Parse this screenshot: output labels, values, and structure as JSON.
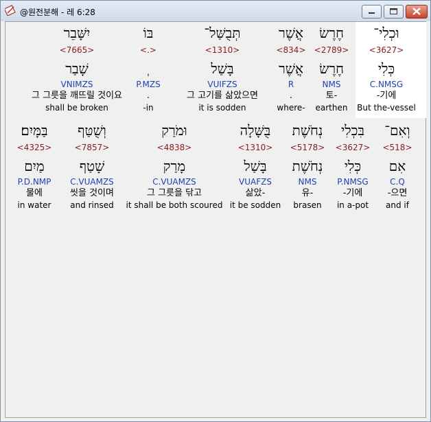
{
  "window": {
    "title": "@원전분해 - 레 6:28",
    "buttons": {
      "minimize": "minimize-icon",
      "maximize": "maximize-icon",
      "close": "close-icon"
    }
  },
  "rows": [
    {
      "words": [
        {
          "heb": "יִשָּׁבֵר",
          "strong": "<7665>",
          "lemma": "שָׁבַר",
          "morph": "VNIMZS",
          "kor": "그 그릇을 깨뜨릴 것이요",
          "eng": "shall be broken"
        },
        {
          "heb": "בּוֹ",
          "strong": "<.>",
          "lemma": "ְ",
          "morph": "P.MZS",
          "kor": ".",
          "eng": "-in"
        },
        {
          "heb": "תְּבֻשַּׁל־",
          "strong": "<1310>",
          "lemma": "בָּשַׁל",
          "morph": "VUIFZS",
          "kor": "그 고기를 삶았으면",
          "eng": "it is sodden"
        },
        {
          "heb": "אֲשֶׁר",
          "strong": "<834>",
          "lemma": "אֲשֶׁר",
          "morph": "R",
          "kor": ".",
          "eng": "where-"
        },
        {
          "heb": "חֶרֶשׂ",
          "strong": "<2789>",
          "lemma": "חֶרֶשׂ",
          "morph": "NMS",
          "kor": "토-",
          "eng": "earthen"
        },
        {
          "heb": "וּכְלִי־",
          "strong": "<3627>",
          "lemma": "כְּלִי",
          "morph": "C.NMSG",
          "kor": "-기에",
          "eng": "But the-vessel"
        }
      ]
    },
    {
      "words": [
        {
          "heb": "בַּמָּיִם׃",
          "strong": "<4325>",
          "lemma": "מַיִם",
          "morph": "P.D.NMP",
          "kor": "물에",
          "eng": "in water"
        },
        {
          "heb": "וְשֻׁטַּף",
          "strong": "<7857>",
          "lemma": "שָׁטַף",
          "morph": "C.VUAMZS",
          "kor": "씻을 것이며",
          "eng": "and rinsed"
        },
        {
          "heb": "וּמֹרַק",
          "strong": "<4838>",
          "lemma": "מָרַק",
          "morph": "C.VUAMZS",
          "kor": "그 그릇을 닦고",
          "eng": "it shall be both scoured"
        },
        {
          "heb": "בֻּשָּׁלָה",
          "strong": "<1310>",
          "lemma": "בָּשַׁל",
          "morph": "VUAFZS",
          "kor": "삶았-",
          "eng": "it be sodden"
        },
        {
          "heb": "נְחֹשֶׁת",
          "strong": "<5178>",
          "lemma": "נְחֹשֶׁת",
          "morph": "NMS",
          "kor": "유-",
          "eng": "brasen"
        },
        {
          "heb": "בִּכְלִי",
          "strong": "<3627>",
          "lemma": "כְּלִי",
          "morph": "P.NMSG",
          "kor": "-기에",
          "eng": "in a-pot"
        },
        {
          "heb": "וְאִם־",
          "strong": "<518>",
          "lemma": "אִם",
          "morph": "C.Q",
          "kor": "-으면",
          "eng": "and if"
        }
      ]
    }
  ]
}
